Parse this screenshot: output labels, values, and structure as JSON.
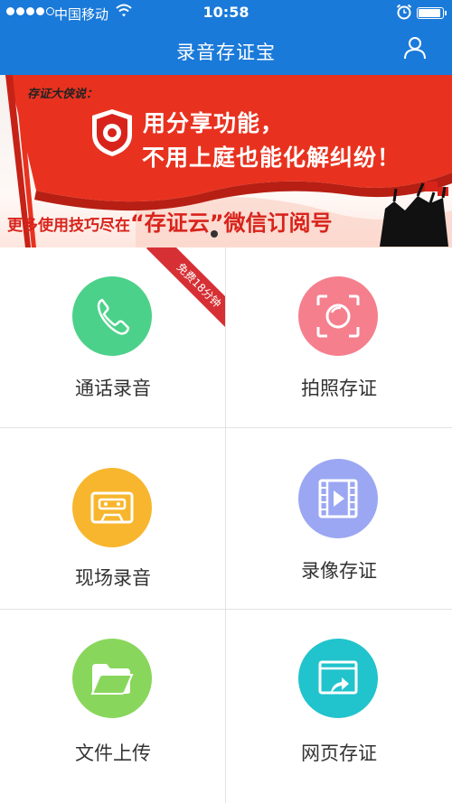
{
  "status_bar": {
    "carrier": "中国移动",
    "time": "10:58"
  },
  "header": {
    "title": "录音存证宝",
    "user_icon": "user-icon"
  },
  "banner": {
    "slogan": "存证大侠说：",
    "line1": "用分享功能，",
    "line2": "不用上庭也能化解纠纷！",
    "bottom_prefix": "更多使用技巧尽在",
    "bottom_highlight": "“存证云”微信订阅号",
    "colors": {
      "red": "#e8321f",
      "text_red": "#d8231b"
    }
  },
  "features": [
    {
      "label": "通话录音",
      "icon": "phone-icon",
      "color": "#4cd18a",
      "badge": "免费18分钟"
    },
    {
      "label": "拍照存证",
      "icon": "camera-icon",
      "color": "#f57f8d"
    },
    {
      "label": "现场录音",
      "icon": "cassette-icon",
      "color": "#f7b62e"
    },
    {
      "label": "录像存证",
      "icon": "video-icon",
      "color": "#9ba7f2"
    },
    {
      "label": "文件上传",
      "icon": "folder-icon",
      "color": "#89d65c"
    },
    {
      "label": "网页存证",
      "icon": "webpage-icon",
      "color": "#21c3cc"
    }
  ]
}
